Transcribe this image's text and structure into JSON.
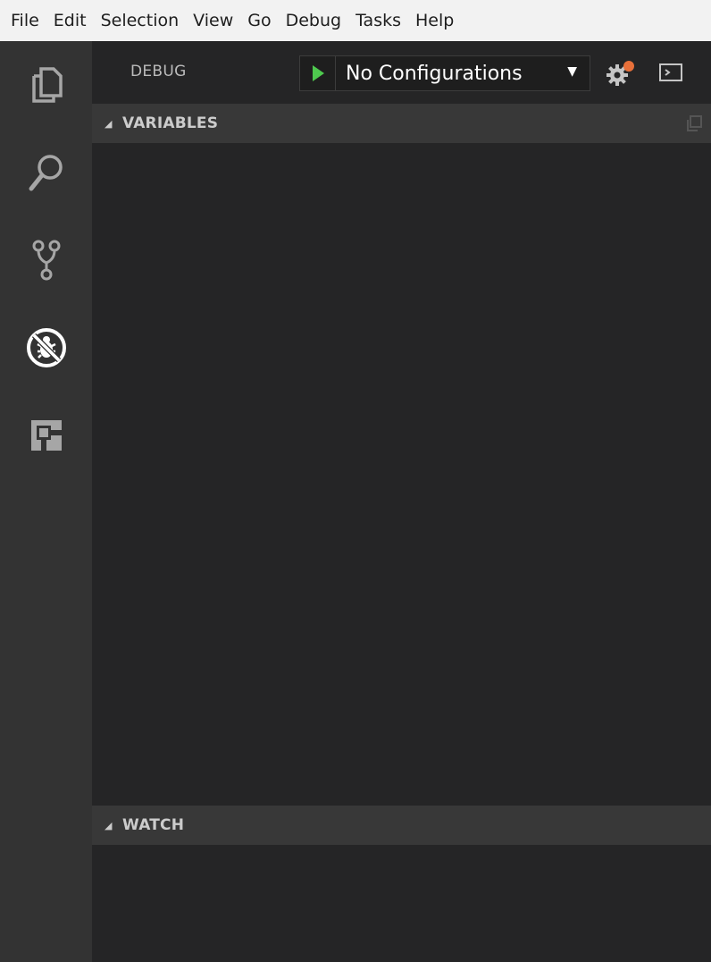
{
  "menubar": {
    "items": [
      "File",
      "Edit",
      "Selection",
      "View",
      "Go",
      "Debug",
      "Tasks",
      "Help"
    ]
  },
  "activitybar": {
    "icons": [
      "explorer-icon",
      "search-icon",
      "source-control-icon",
      "debug-icon",
      "extensions-icon"
    ]
  },
  "debug": {
    "title": "DEBUG",
    "configuration": "No Configurations",
    "play_color": "#4ec94e",
    "gear_badge_color": "#e8703a"
  },
  "sections": {
    "variables": "VARIABLES",
    "watch": "WATCH"
  }
}
